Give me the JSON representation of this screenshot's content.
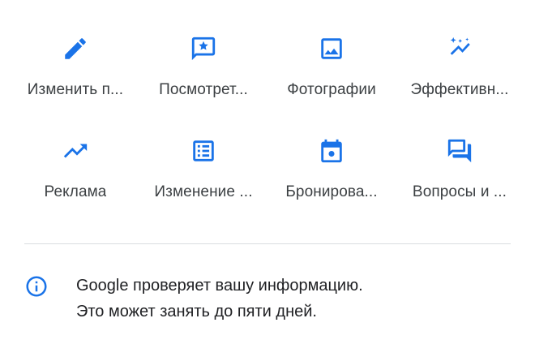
{
  "actions": [
    {
      "label": "Изменить п...",
      "icon": "pencil-icon"
    },
    {
      "label": "Посмотрет...",
      "icon": "review-star-icon"
    },
    {
      "label": "Фотографии",
      "icon": "photo-icon"
    },
    {
      "label": "Эффективн...",
      "icon": "performance-sparkle-icon"
    },
    {
      "label": "Реклама",
      "icon": "trending-up-icon"
    },
    {
      "label": "Изменение ...",
      "icon": "list-icon"
    },
    {
      "label": "Бронирова...",
      "icon": "calendar-icon"
    },
    {
      "label": "Вопросы и ...",
      "icon": "question-answer-icon"
    }
  ],
  "notice": {
    "line1": "Google проверяет вашу информацию.",
    "line2": "Это может занять до пяти дней.",
    "icon": "info-icon"
  },
  "colors": {
    "accent": "#1a73e8",
    "text": "#3c4043",
    "divider": "#dadce0"
  }
}
